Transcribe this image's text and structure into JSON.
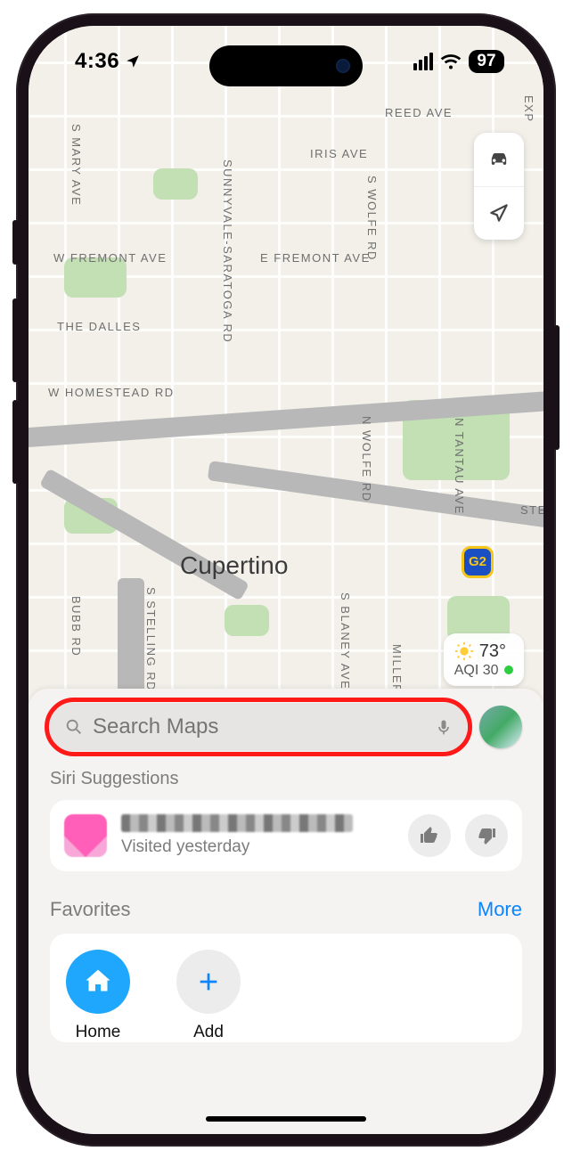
{
  "status": {
    "time": "4:36",
    "battery": "97"
  },
  "map": {
    "city": "Cupertino",
    "labels": {
      "reed": "REED AVE",
      "iris": "IRIS AVE",
      "efremont": "E FREMONT AVE",
      "wfremont": "W FREMONT AVE",
      "thedalles": "THE DALLES",
      "homestead": "W HOMESTEAD RD",
      "smary": "S MARY AVE",
      "sunny": "SUNNYVALE-SARATOGA RD",
      "swolfe": "S WOLFE RD",
      "nwolfe": "N WOLFE RD",
      "sblaney": "S BLANEY AVE",
      "miller": "MILLER AVE",
      "ntantau": "N TANTAU AVE",
      "bubb": "BUBB RD",
      "stelling": "S STELLING RD",
      "exp": "EXP",
      "ste": "STE"
    },
    "route_badge": "G2",
    "weather": {
      "temp": "73°",
      "aqi_label": "AQI 30"
    }
  },
  "search": {
    "placeholder": "Search Maps"
  },
  "siri": {
    "heading": "Siri Suggestions",
    "item_subtitle": "Visited yesterday"
  },
  "favorites": {
    "heading": "Favorites",
    "more": "More",
    "home_label": "Home",
    "add_label": "Add"
  }
}
